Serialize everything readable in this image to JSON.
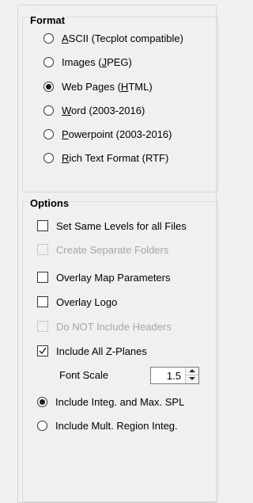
{
  "format": {
    "title": "Format",
    "options": [
      {
        "pre": "",
        "u": "A",
        "post": "SCII (Tecplot compatible)",
        "checked": false
      },
      {
        "pre": "Images (",
        "u": "J",
        "post": "PEG)",
        "checked": false
      },
      {
        "pre": "Web Pages (",
        "u": "H",
        "post": "TML)",
        "checked": true
      },
      {
        "pre": "",
        "u": "W",
        "post": "ord (2003-2016)",
        "checked": false
      },
      {
        "pre": "",
        "u": "P",
        "post": "owerpoint (2003-2016)",
        "checked": false
      },
      {
        "pre": "",
        "u": "R",
        "post": "ich Text Format (RTF)",
        "checked": false
      }
    ]
  },
  "options": {
    "title": "Options",
    "checkboxes": [
      {
        "label": "Set Same Levels for all Files",
        "checked": false,
        "disabled": false
      },
      {
        "label": "Create Separate Folders",
        "checked": false,
        "disabled": true
      },
      {
        "label": "Overlay Map Parameters",
        "checked": false,
        "disabled": false
      },
      {
        "label": "Overlay Logo",
        "checked": false,
        "disabled": false
      },
      {
        "label": "Do NOT Include Headers",
        "checked": false,
        "disabled": true
      },
      {
        "label": "Include All Z-Planes",
        "checked": true,
        "disabled": false
      }
    ],
    "font_scale": {
      "label": "Font Scale",
      "value": "1.5"
    },
    "radios": [
      {
        "label": "Include Integ. and Max. SPL",
        "checked": true
      },
      {
        "label": "Include Mult. Region Integ.",
        "checked": false
      }
    ]
  }
}
